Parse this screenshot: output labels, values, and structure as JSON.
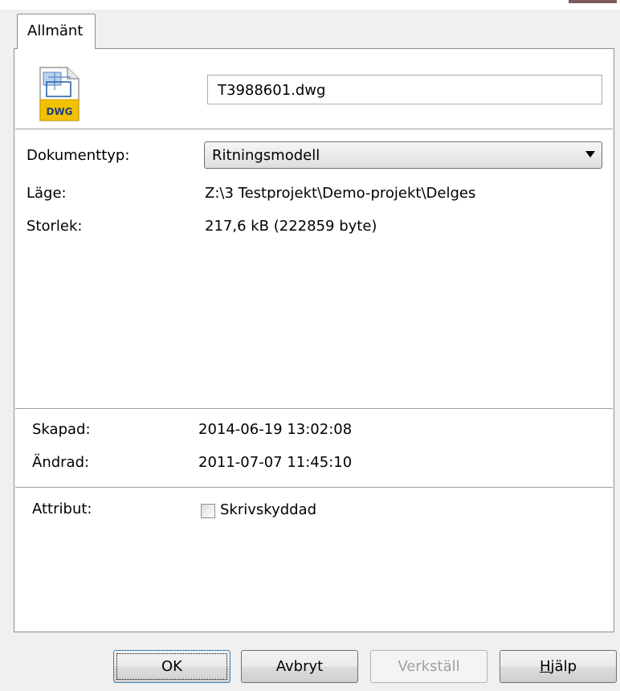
{
  "tabs": [
    {
      "label": "Allmänt"
    }
  ],
  "file": {
    "name": "T3988601.dwg",
    "icon_text": "DWG",
    "icon": "dwg-file-icon"
  },
  "fields": {
    "doc_type_label": "Dokumenttyp:",
    "doc_type_value": "Ritningsmodell",
    "location_label": "Läge:",
    "location_value": "Z:\\3 Testprojekt\\Demo-projekt\\Delges",
    "size_label": "Storlek:",
    "size_value": "217,6 kB (222859 byte)",
    "created_label": "Skapad:",
    "created_value": "2014-06-19 13:02:08",
    "modified_label": "Ändrad:",
    "modified_value": "2011-07-07 11:45:10",
    "attributes_label": "Attribut:",
    "readonly_label": "Skrivskyddad",
    "readonly_checked": false
  },
  "buttons": {
    "ok": "OK",
    "cancel": "Avbryt",
    "apply": "Verkställ",
    "help_prefix": "",
    "help_mnemonic": "H",
    "help_rest": "jälp"
  },
  "colors": {
    "icon_yellow": "#f2c200",
    "icon_blue": "#1f5aa6"
  }
}
